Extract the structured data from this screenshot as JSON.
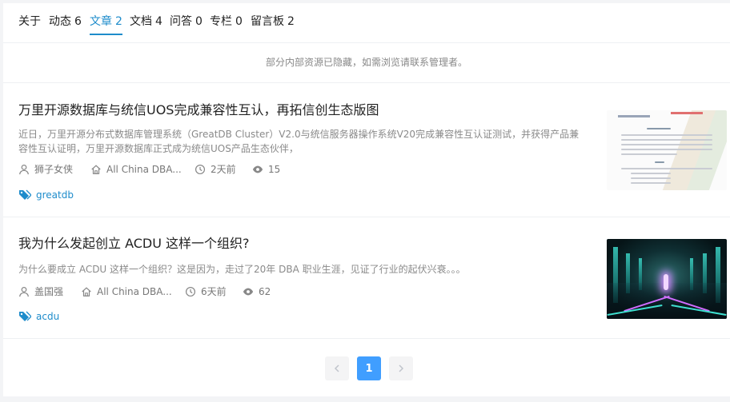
{
  "tabs": [
    {
      "label": "关于",
      "count": ""
    },
    {
      "label": "动态",
      "count": "6"
    },
    {
      "label": "文章",
      "count": "2"
    },
    {
      "label": "文档",
      "count": "4"
    },
    {
      "label": "问答",
      "count": "0"
    },
    {
      "label": "专栏",
      "count": "0"
    },
    {
      "label": "留言板",
      "count": "2"
    }
  ],
  "notice": "部分内部资源已隐藏，如需浏览请联系管理者。",
  "articles": [
    {
      "title": "万里开源数据库与统信UOS完成兼容性互认，再拓信创生态版图",
      "summary": "近日，万里开源分布式数据库管理系统（GreatDB Cluster）V2.0与统信服务器操作系统V20完成兼容性互认证测试，并获得产品兼容性互认证明，万里开源数据库正式成为统信UOS产品生态伙伴，",
      "author": "狮子女侠",
      "community": "All China DBA...",
      "time": "2天前",
      "views": "15",
      "tag": "greatdb"
    },
    {
      "title": "我为什么发起创立 ACDU 这样一个组织?",
      "summary": "为什么要成立 ACDU 这样一个组织？这是因为，走过了20年 DBA 职业生涯，见证了行业的起伏兴衰。。。",
      "author": "盖国强",
      "community": "All China DBA...",
      "time": "6天前",
      "views": "62",
      "tag": "acdu"
    }
  ],
  "pagination": {
    "current": "1"
  },
  "colors": {
    "accent": "#1e8ccb",
    "pager_active": "#409eff"
  }
}
